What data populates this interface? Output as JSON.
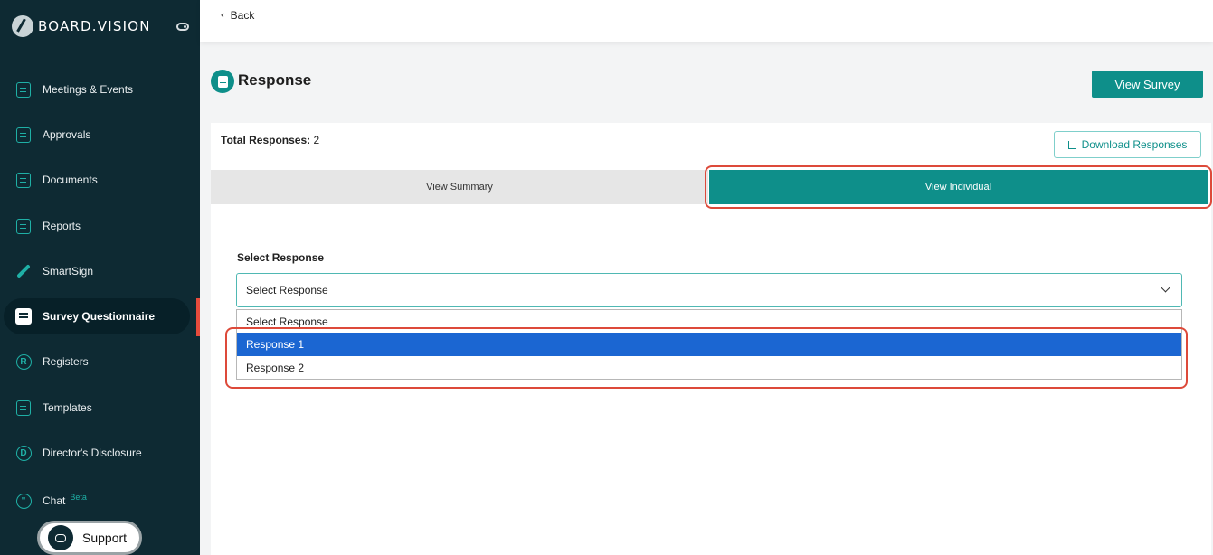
{
  "sidebar": {
    "brand": "BOARD.VISION",
    "items": [
      {
        "label": "Meetings & Events",
        "icon": "calendar-check-icon"
      },
      {
        "label": "Approvals",
        "icon": "approval-doc-icon"
      },
      {
        "label": "Documents",
        "icon": "documents-icon"
      },
      {
        "label": "Reports",
        "icon": "reports-icon"
      },
      {
        "label": "SmartSign",
        "icon": "pen-icon"
      },
      {
        "label": "Survey Questionnaire",
        "icon": "survey-icon"
      },
      {
        "label": "Registers",
        "icon": "registers-icon"
      },
      {
        "label": "Templates",
        "icon": "templates-icon"
      },
      {
        "label": "Director's Disclosure",
        "icon": "disclosure-icon"
      },
      {
        "label": "Chat",
        "icon": "chat-icon",
        "badge": "Beta"
      }
    ],
    "active_item": "Survey Questionnaire",
    "support_label": "Support"
  },
  "topbar": {
    "back_label": "Back"
  },
  "page": {
    "title": "Response",
    "view_survey_label": "View Survey"
  },
  "summary": {
    "total_label": "Total Responses:",
    "total_value": "2",
    "download_label": "Download Responses"
  },
  "tabs": [
    {
      "label": "View Summary",
      "active": false
    },
    {
      "label": "View Individual",
      "active": true
    }
  ],
  "select": {
    "label": "Select Response",
    "value": "Select Response",
    "options": [
      "Select Response",
      "Response 1",
      "Response 2"
    ],
    "highlighted_option": "Response 1"
  },
  "colors": {
    "sidebar_bg": "#0e2a33",
    "accent": "#0e8f8a",
    "highlight": "#dd4a3a",
    "option_selected": "#1b66d2"
  }
}
